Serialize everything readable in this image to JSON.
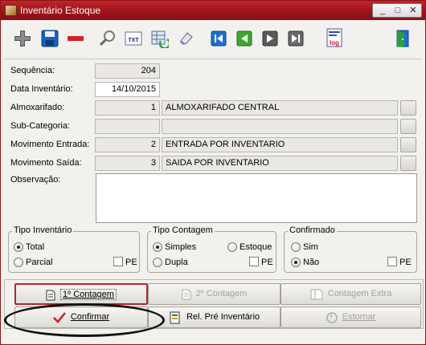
{
  "window": {
    "title": "Inventário Estoque",
    "controls": [
      "_",
      "□",
      "✕"
    ]
  },
  "toolbar": {
    "buttons": [
      {
        "name": "add",
        "icon": "plus-icon"
      },
      {
        "name": "save",
        "icon": "floppy-icon"
      },
      {
        "name": "delete",
        "icon": "minus-icon"
      },
      {
        "name": "search",
        "icon": "magnifier-icon"
      },
      {
        "name": "txt",
        "icon": "txt-icon",
        "label": "TXT"
      },
      {
        "name": "refresh",
        "icon": "refresh-grid-icon"
      },
      {
        "name": "clear",
        "icon": "eraser-icon"
      },
      {
        "name": "first",
        "icon": "first-record-icon"
      },
      {
        "name": "previous",
        "icon": "previous-record-icon"
      },
      {
        "name": "next",
        "icon": "next-record-icon"
      },
      {
        "name": "last",
        "icon": "last-record-icon"
      },
      {
        "name": "log",
        "icon": "log-icon",
        "label": "log"
      },
      {
        "name": "exit",
        "icon": "exit-door-icon"
      }
    ]
  },
  "form": {
    "sequencia": {
      "label": "Sequência:",
      "value": "204"
    },
    "data_inventario": {
      "label": "Data Inventário:",
      "value": "14/10/2015"
    },
    "almoxarifado": {
      "label": "Almoxarifado:",
      "code": "1",
      "description": "ALMOXARIFADO CENTRAL"
    },
    "subcategoria": {
      "label": "Sub-Categoria:",
      "code": "",
      "description": ""
    },
    "movimento_entrada": {
      "label": "Movimento Entrada:",
      "code": "2",
      "description": "ENTRADA POR INVENTARIO"
    },
    "movimento_saida": {
      "label": "Movimento Saída:",
      "code": "3",
      "description": "SAIDA POR INVENTARIO"
    },
    "observacao": {
      "label": "Observação:",
      "value": ""
    }
  },
  "groups": {
    "tipo_inventario": {
      "title": "Tipo Inventário",
      "options": [
        "Total",
        "Parcial"
      ],
      "selected": "Total",
      "pe_label": "PE",
      "pe_checked": false
    },
    "tipo_contagem": {
      "title": "Tipo Contagem",
      "options": [
        "Simples",
        "Estoque",
        "Dupla"
      ],
      "selected": "Simples",
      "pe_label": "PE",
      "pe_checked": false
    },
    "confirmado": {
      "title": "Confirmado",
      "options": [
        "Sim",
        "Não"
      ],
      "selected": "Não",
      "pe_label": "PE",
      "pe_checked": false
    }
  },
  "actions": {
    "contagem1": "1º Contagem",
    "contagem2": "2º Contagem",
    "contagem_extra": "Contagem Extra",
    "confirmar": "Confirmar",
    "rel_pre_inventario": "Rel. Pré Inventário",
    "estornar": "Estornar"
  },
  "colors": {
    "titlebar": "#a8191f",
    "confirm_check": "#d21b22",
    "nav_buttons": "#1f6fcf",
    "green_nav": "#3da82e"
  }
}
